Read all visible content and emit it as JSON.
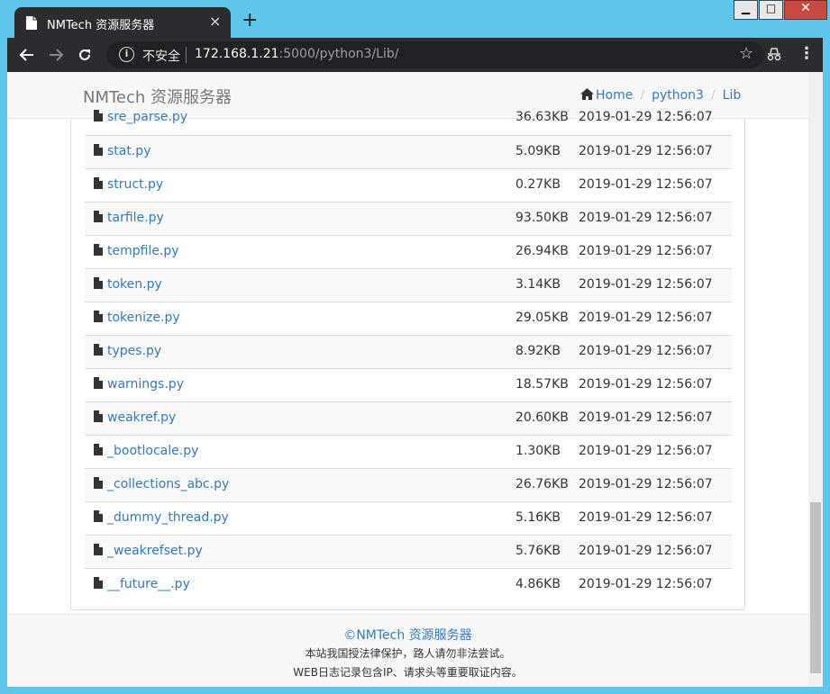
{
  "browser": {
    "tab_title": "NMTech 资源服务器",
    "tab_close": "×",
    "new_tab": "+",
    "security_label": "不安全",
    "url_host": "172.168.1.21",
    "url_rest": ":5000/python3/Lib/",
    "window_controls": {
      "minimize": "▁",
      "maximize": "□",
      "close": "✕"
    }
  },
  "navbar": {
    "brand": "NMTech 资源服务器",
    "breadcrumb": {
      "home": "Home",
      "dir1": "python3",
      "dir2": "Lib",
      "divider": "/"
    }
  },
  "files": [
    {
      "name": "sre_parse.py",
      "size": "36.63KB",
      "time": "2019-01-29 12:56:07"
    },
    {
      "name": "stat.py",
      "size": "5.09KB",
      "time": "2019-01-29 12:56:07"
    },
    {
      "name": "struct.py",
      "size": "0.27KB",
      "time": "2019-01-29 12:56:07"
    },
    {
      "name": "tarfile.py",
      "size": "93.50KB",
      "time": "2019-01-29 12:56:07"
    },
    {
      "name": "tempfile.py",
      "size": "26.94KB",
      "time": "2019-01-29 12:56:07"
    },
    {
      "name": "token.py",
      "size": "3.14KB",
      "time": "2019-01-29 12:56:07"
    },
    {
      "name": "tokenize.py",
      "size": "29.05KB",
      "time": "2019-01-29 12:56:07"
    },
    {
      "name": "types.py",
      "size": "8.92KB",
      "time": "2019-01-29 12:56:07"
    },
    {
      "name": "warnings.py",
      "size": "18.57KB",
      "time": "2019-01-29 12:56:07"
    },
    {
      "name": "weakref.py",
      "size": "20.60KB",
      "time": "2019-01-29 12:56:07"
    },
    {
      "name": "_bootlocale.py",
      "size": "1.30KB",
      "time": "2019-01-29 12:56:07"
    },
    {
      "name": "_collections_abc.py",
      "size": "26.76KB",
      "time": "2019-01-29 12:56:07"
    },
    {
      "name": "_dummy_thread.py",
      "size": "5.16KB",
      "time": "2019-01-29 12:56:07"
    },
    {
      "name": "_weakrefset.py",
      "size": "5.76KB",
      "time": "2019-01-29 12:56:07"
    },
    {
      "name": "__future__.py",
      "size": "4.86KB",
      "time": "2019-01-29 12:56:07"
    }
  ],
  "footer": {
    "copyright": "©NMTech 资源服务器",
    "line1": "本站我国授法律保护，路人请勿非法尝试。",
    "line2": "WEB日志记录包含IP、请求头等重要取证内容。"
  },
  "icons": {
    "favicon": "file-icon",
    "back": "arrow-left-icon",
    "forward": "arrow-right-icon",
    "reload": "reload-icon",
    "info": "info-icon",
    "bookmark": "star-icon",
    "extension": "incognito-icon",
    "menu": "kebab-menu-icon",
    "home": "home-icon",
    "file": "file-icon"
  },
  "colors": {
    "link": "#337ab7",
    "titlebar": "#5ec6ea",
    "toolbar": "#2a2c30",
    "stripe": "#f9f9f9"
  }
}
